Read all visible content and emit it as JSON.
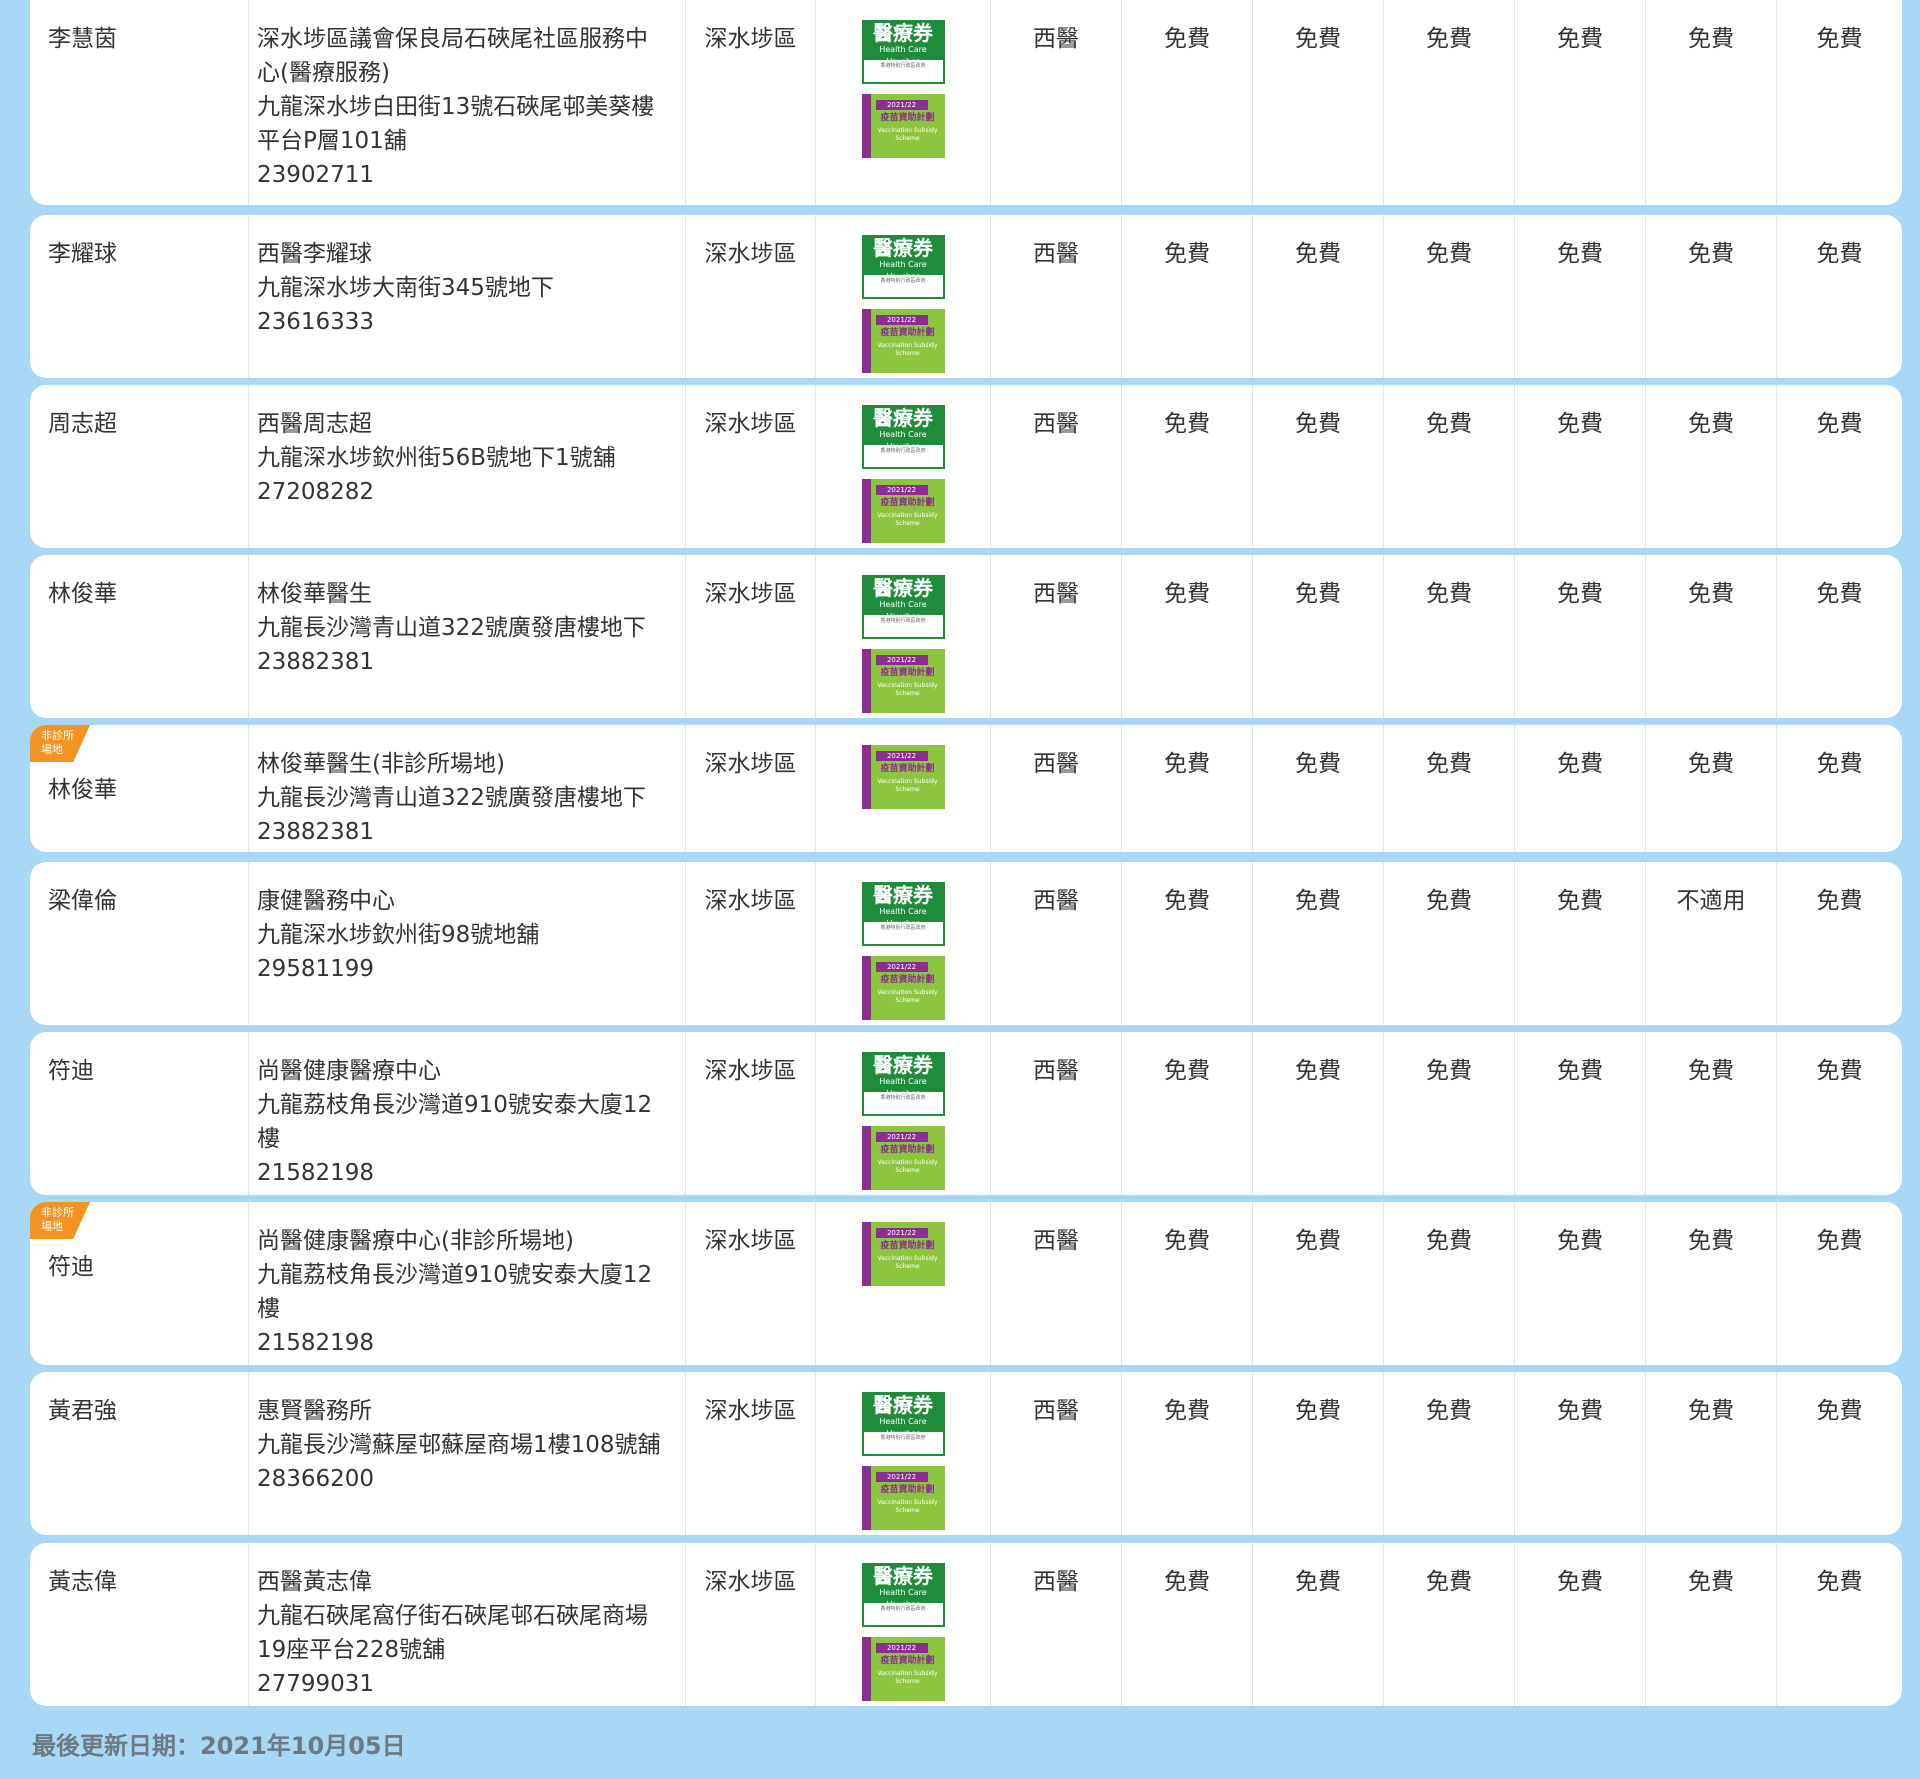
{
  "rows": [
    {
      "name": "李慧茵",
      "tag": "",
      "clinic_lines": [
        "深水埗區議會保良局石硤尾社區服務中",
        "心(醫療服務)",
        "九龍深水埗白田街13號石硤尾邨美葵樓",
        "平台P層101舖",
        "23902711"
      ],
      "district": "深水埗區",
      "vouchers": [
        "hcv",
        "vss"
      ],
      "specialty": "西醫",
      "fees": [
        "免費",
        "免費",
        "免費",
        "免費",
        "免費",
        "免費"
      ]
    },
    {
      "name": "李耀球",
      "tag": "",
      "clinic_lines": [
        "西醫李耀球",
        "九龍深水埗大南街345號地下",
        "23616333"
      ],
      "district": "深水埗區",
      "vouchers": [
        "hcv",
        "vss"
      ],
      "specialty": "西醫",
      "fees": [
        "免費",
        "免費",
        "免費",
        "免費",
        "免費",
        "免費"
      ]
    },
    {
      "name": "周志超",
      "tag": "",
      "clinic_lines": [
        "西醫周志超",
        "九龍深水埗欽州街56B號地下1號舖",
        "27208282"
      ],
      "district": "深水埗區",
      "vouchers": [
        "hcv",
        "vss"
      ],
      "specialty": "西醫",
      "fees": [
        "免費",
        "免費",
        "免費",
        "免費",
        "免費",
        "免費"
      ]
    },
    {
      "name": "林俊華",
      "tag": "",
      "clinic_lines": [
        "林俊華醫生",
        "九龍長沙灣青山道322號廣發唐樓地下",
        "23882381"
      ],
      "district": "深水埗區",
      "vouchers": [
        "hcv",
        "vss"
      ],
      "specialty": "西醫",
      "fees": [
        "免費",
        "免費",
        "免費",
        "免費",
        "免費",
        "免費"
      ]
    },
    {
      "name": "林俊華",
      "tag": "非診所\n場地",
      "clinic_lines": [
        "林俊華醫生(非診所場地)",
        "九龍長沙灣青山道322號廣發唐樓地下",
        "23882381"
      ],
      "district": "深水埗區",
      "vouchers": [
        "vss"
      ],
      "specialty": "西醫",
      "fees": [
        "免費",
        "免費",
        "免費",
        "免費",
        "免費",
        "免費"
      ]
    },
    {
      "name": "梁偉倫",
      "tag": "",
      "clinic_lines": [
        "康健醫務中心",
        "九龍深水埗欽州街98號地舖",
        "29581199"
      ],
      "district": "深水埗區",
      "vouchers": [
        "hcv",
        "vss"
      ],
      "specialty": "西醫",
      "fees": [
        "免費",
        "免費",
        "免費",
        "免費",
        "不適用",
        "免費"
      ]
    },
    {
      "name": "符迪",
      "tag": "",
      "clinic_lines": [
        "尚醫健康醫療中心",
        "九龍荔枝角長沙灣道910號安泰大廈12",
        "樓",
        "21582198"
      ],
      "district": "深水埗區",
      "vouchers": [
        "hcv",
        "vss"
      ],
      "specialty": "西醫",
      "fees": [
        "免費",
        "免費",
        "免費",
        "免費",
        "免費",
        "免費"
      ]
    },
    {
      "name": "符迪",
      "tag": "非診所\n場地",
      "clinic_lines": [
        "尚醫健康醫療中心(非診所場地)",
        "九龍荔枝角長沙灣道910號安泰大廈12",
        "樓",
        "21582198"
      ],
      "district": "深水埗區",
      "vouchers": [
        "vss"
      ],
      "specialty": "西醫",
      "fees": [
        "免費",
        "免費",
        "免費",
        "免費",
        "免費",
        "免費"
      ]
    },
    {
      "name": "黃君強",
      "tag": "",
      "clinic_lines": [
        "惠賢醫務所",
        "九龍長沙灣蘇屋邨蘇屋商場1樓108號舖",
        "28366200"
      ],
      "district": "深水埗區",
      "vouchers": [
        "hcv",
        "vss"
      ],
      "specialty": "西醫",
      "fees": [
        "免費",
        "免費",
        "免費",
        "免費",
        "免費",
        "免費"
      ]
    },
    {
      "name": "黃志偉",
      "tag": "",
      "clinic_lines": [
        "西醫黃志偉",
        "九龍石硤尾窩仔街石硤尾邨石硤尾商場",
        "19座平台228號舖",
        "27799031"
      ],
      "district": "深水埗區",
      "vouchers": [
        "hcv",
        "vss"
      ],
      "specialty": "西醫",
      "fees": [
        "免費",
        "免費",
        "免費",
        "免費",
        "免費",
        "免費"
      ]
    }
  ],
  "voucher_labels": {
    "hcv_title": "醫療券",
    "hcv_sub": "Health Care Voucher",
    "hcv_note": "香港特別行政區政府",
    "vss_year": "2021/22",
    "vss_title": "疫苗資助計劃",
    "vss_en": "Vaccination Subsidy Scheme"
  },
  "footer": "最後更新日期：2021年10月05日"
}
